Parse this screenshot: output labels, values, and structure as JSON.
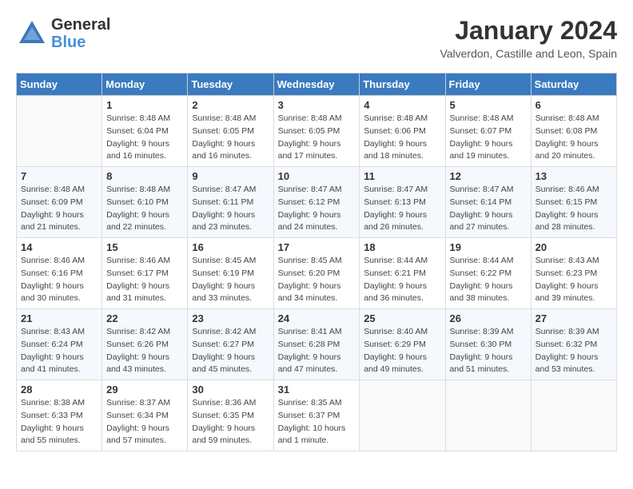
{
  "logo": {
    "general": "General",
    "blue": "Blue"
  },
  "title": "January 2024",
  "location": "Valverdon, Castille and Leon, Spain",
  "days_of_week": [
    "Sunday",
    "Monday",
    "Tuesday",
    "Wednesday",
    "Thursday",
    "Friday",
    "Saturday"
  ],
  "weeks": [
    [
      {
        "day": "",
        "info": ""
      },
      {
        "day": "1",
        "info": "Sunrise: 8:48 AM\nSunset: 6:04 PM\nDaylight: 9 hours\nand 16 minutes."
      },
      {
        "day": "2",
        "info": "Sunrise: 8:48 AM\nSunset: 6:05 PM\nDaylight: 9 hours\nand 16 minutes."
      },
      {
        "day": "3",
        "info": "Sunrise: 8:48 AM\nSunset: 6:05 PM\nDaylight: 9 hours\nand 17 minutes."
      },
      {
        "day": "4",
        "info": "Sunrise: 8:48 AM\nSunset: 6:06 PM\nDaylight: 9 hours\nand 18 minutes."
      },
      {
        "day": "5",
        "info": "Sunrise: 8:48 AM\nSunset: 6:07 PM\nDaylight: 9 hours\nand 19 minutes."
      },
      {
        "day": "6",
        "info": "Sunrise: 8:48 AM\nSunset: 6:08 PM\nDaylight: 9 hours\nand 20 minutes."
      }
    ],
    [
      {
        "day": "7",
        "info": "Sunrise: 8:48 AM\nSunset: 6:09 PM\nDaylight: 9 hours\nand 21 minutes."
      },
      {
        "day": "8",
        "info": "Sunrise: 8:48 AM\nSunset: 6:10 PM\nDaylight: 9 hours\nand 22 minutes."
      },
      {
        "day": "9",
        "info": "Sunrise: 8:47 AM\nSunset: 6:11 PM\nDaylight: 9 hours\nand 23 minutes."
      },
      {
        "day": "10",
        "info": "Sunrise: 8:47 AM\nSunset: 6:12 PM\nDaylight: 9 hours\nand 24 minutes."
      },
      {
        "day": "11",
        "info": "Sunrise: 8:47 AM\nSunset: 6:13 PM\nDaylight: 9 hours\nand 26 minutes."
      },
      {
        "day": "12",
        "info": "Sunrise: 8:47 AM\nSunset: 6:14 PM\nDaylight: 9 hours\nand 27 minutes."
      },
      {
        "day": "13",
        "info": "Sunrise: 8:46 AM\nSunset: 6:15 PM\nDaylight: 9 hours\nand 28 minutes."
      }
    ],
    [
      {
        "day": "14",
        "info": "Sunrise: 8:46 AM\nSunset: 6:16 PM\nDaylight: 9 hours\nand 30 minutes."
      },
      {
        "day": "15",
        "info": "Sunrise: 8:46 AM\nSunset: 6:17 PM\nDaylight: 9 hours\nand 31 minutes."
      },
      {
        "day": "16",
        "info": "Sunrise: 8:45 AM\nSunset: 6:19 PM\nDaylight: 9 hours\nand 33 minutes."
      },
      {
        "day": "17",
        "info": "Sunrise: 8:45 AM\nSunset: 6:20 PM\nDaylight: 9 hours\nand 34 minutes."
      },
      {
        "day": "18",
        "info": "Sunrise: 8:44 AM\nSunset: 6:21 PM\nDaylight: 9 hours\nand 36 minutes."
      },
      {
        "day": "19",
        "info": "Sunrise: 8:44 AM\nSunset: 6:22 PM\nDaylight: 9 hours\nand 38 minutes."
      },
      {
        "day": "20",
        "info": "Sunrise: 8:43 AM\nSunset: 6:23 PM\nDaylight: 9 hours\nand 39 minutes."
      }
    ],
    [
      {
        "day": "21",
        "info": "Sunrise: 8:43 AM\nSunset: 6:24 PM\nDaylight: 9 hours\nand 41 minutes."
      },
      {
        "day": "22",
        "info": "Sunrise: 8:42 AM\nSunset: 6:26 PM\nDaylight: 9 hours\nand 43 minutes."
      },
      {
        "day": "23",
        "info": "Sunrise: 8:42 AM\nSunset: 6:27 PM\nDaylight: 9 hours\nand 45 minutes."
      },
      {
        "day": "24",
        "info": "Sunrise: 8:41 AM\nSunset: 6:28 PM\nDaylight: 9 hours\nand 47 minutes."
      },
      {
        "day": "25",
        "info": "Sunrise: 8:40 AM\nSunset: 6:29 PM\nDaylight: 9 hours\nand 49 minutes."
      },
      {
        "day": "26",
        "info": "Sunrise: 8:39 AM\nSunset: 6:30 PM\nDaylight: 9 hours\nand 51 minutes."
      },
      {
        "day": "27",
        "info": "Sunrise: 8:39 AM\nSunset: 6:32 PM\nDaylight: 9 hours\nand 53 minutes."
      }
    ],
    [
      {
        "day": "28",
        "info": "Sunrise: 8:38 AM\nSunset: 6:33 PM\nDaylight: 9 hours\nand 55 minutes."
      },
      {
        "day": "29",
        "info": "Sunrise: 8:37 AM\nSunset: 6:34 PM\nDaylight: 9 hours\nand 57 minutes."
      },
      {
        "day": "30",
        "info": "Sunrise: 8:36 AM\nSunset: 6:35 PM\nDaylight: 9 hours\nand 59 minutes."
      },
      {
        "day": "31",
        "info": "Sunrise: 8:35 AM\nSunset: 6:37 PM\nDaylight: 10 hours\nand 1 minute."
      },
      {
        "day": "",
        "info": ""
      },
      {
        "day": "",
        "info": ""
      },
      {
        "day": "",
        "info": ""
      }
    ]
  ]
}
